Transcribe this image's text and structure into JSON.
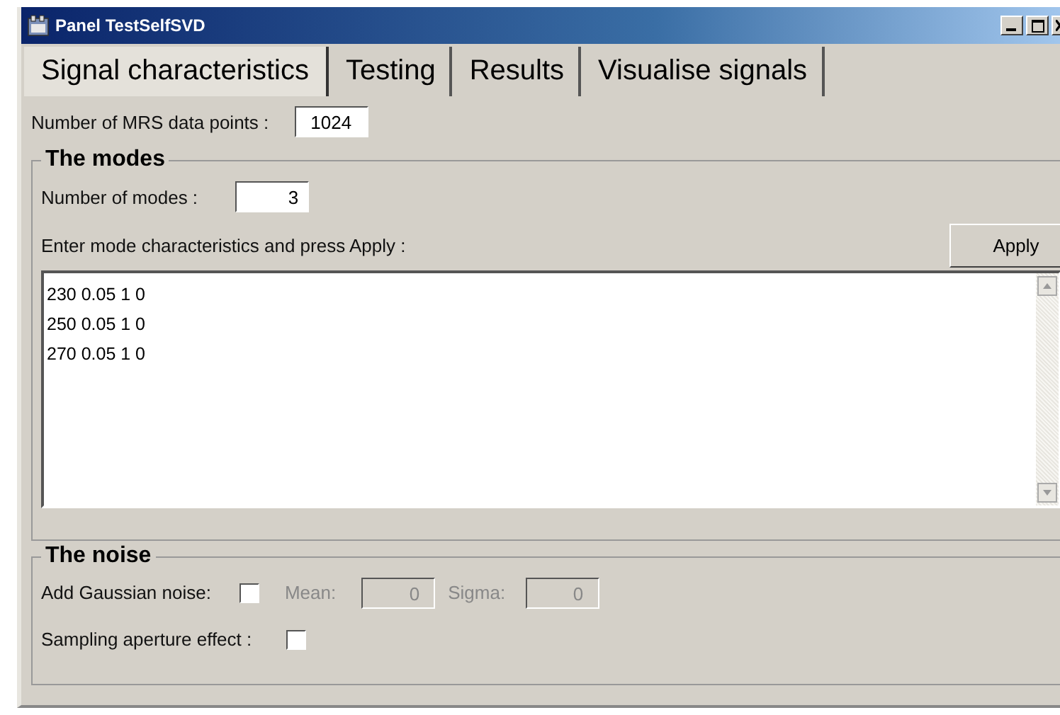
{
  "window": {
    "title": "Panel TestSelfSVD"
  },
  "tabs": [
    {
      "label": "Signal characteristics",
      "selected": true
    },
    {
      "label": "Testing",
      "selected": false
    },
    {
      "label": "Results",
      "selected": false
    },
    {
      "label": "Visualise signals",
      "selected": false
    }
  ],
  "data_points": {
    "label": "Number of MRS data points :",
    "value": "1024"
  },
  "modes": {
    "title": "The modes",
    "count_label": "Number of modes :",
    "count_value": "3",
    "instruction": "Enter mode characteristics and press Apply :",
    "apply": "Apply",
    "lines": [
      "230 0.05 1 0",
      "250 0.05 1 0",
      "270 0.05 1 0"
    ]
  },
  "noise": {
    "title": "The noise",
    "gaussian": {
      "label": "Add Gaussian noise:",
      "checked": false
    },
    "mean": {
      "label": "Mean:",
      "value": "0",
      "disabled": true
    },
    "sigma": {
      "label": "Sigma:",
      "value": "0",
      "disabled": true
    },
    "aperture": {
      "label": "Sampling aperture effect :",
      "checked": false
    }
  }
}
